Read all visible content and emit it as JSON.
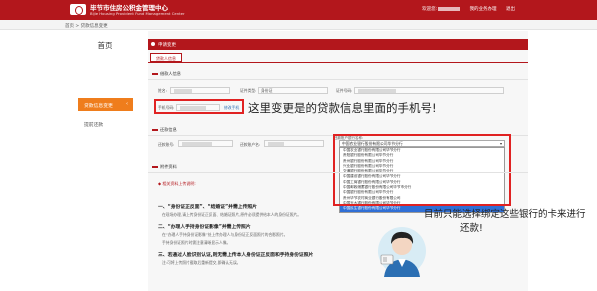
{
  "header": {
    "title": "毕节市住房公积金管理中心",
    "subtitle": "Bijie Housing Provident Fund Management Center",
    "welcome": "欢迎您:",
    "links": [
      "我的业务办理",
      "退出"
    ]
  },
  "breadcrumb": "首页 > 贷款信息变更",
  "sidebar": {
    "home": "首页",
    "items": [
      {
        "label": "贷款信息变更",
        "arrow": "‹"
      },
      {
        "label": "提前还款"
      }
    ]
  },
  "panel": {
    "title": "申请变更",
    "tab_button": "贷款人信息"
  },
  "borrower_section": {
    "title": "借款人信息",
    "name_label": "姓名:",
    "id_type_label": "证件类型:",
    "id_type_value": "身份证",
    "id_no_label": "证件号码:",
    "mobile_label": "手机号码:",
    "change_mobile_btn": "修改手机"
  },
  "repay_section": {
    "title": "还款信息",
    "card_label": "还款账号:",
    "holder_label": "还款账户名:",
    "bank_label": "还款账户银行名称:",
    "bank_selected": "中国农业银行股份有限公司毕节分行",
    "bank_options": [
      "中国农业银行股份有限公司毕节分行",
      "贵阳银行股份有限公司毕节分行",
      "贵州银行股份有限公司毕节分行",
      "兴业银行股份有限公司毕节分行",
      "交通银行股份有限公司毕节分行",
      "中国建设银行股份有限公司毕节分行",
      "中国工商银行股份有限公司毕节分行",
      "中国邮政储蓄银行股份有限公司毕节市分行",
      "中国银行股份有限公司毕节分行",
      "贵州毕节农村商业银行股份有限公司",
      "中国光大银行股份有限公司毕节分行",
      "中国民生银行股份有限公司毕节分行"
    ],
    "selected_index": 11
  },
  "attach_section": {
    "title": "附件资料",
    "upload_link": "◆ 相关资料上传说明:",
    "instructions": [
      {
        "head": "一、“身份证正反面”、“结婚证”并需上传照片",
        "sub": "在现场办理,请上传身份证正反面、结婚证照片,原件必须提供给本人的身份证照片。"
      },
      {
        "head": "二、“办理人手持身份证影像”并需上传照片",
        "sub": "在“办理人手持身份证影像”处上传办理人与身份证正反面照片的合影照片。"
      },
      {
        "head": "",
        "sub": "手持身份证照片时需注意清晰显示人像。"
      },
      {
        "head": "三、若通过人脸识别认证,则无需上传本人身份证正反面和手持身份证照片",
        "sub": "注:可将上传照片截取后重新提交,即确认无误。"
      }
    ]
  },
  "annotations": {
    "mobile_note": "这里变更是的贷款信息里面的手机号!",
    "bank_note_line1": "目前只能选择绑定这些银行的卡来进行",
    "bank_note_line2": "还款!"
  },
  "colors": {
    "brand_red": "#b3171c",
    "accent_orange": "#ef7d1c",
    "annotation_red": "#e02222",
    "selected_blue": "#2f6fd6"
  }
}
